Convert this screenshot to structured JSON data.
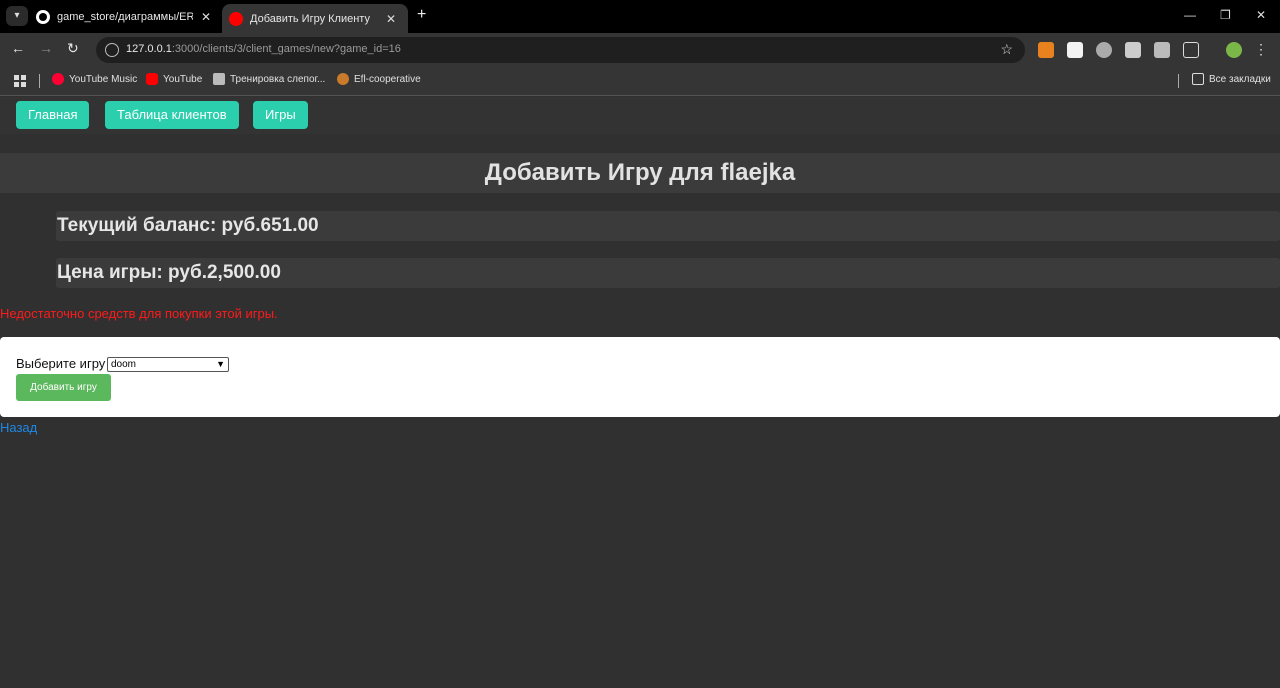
{
  "browser": {
    "tabs": [
      {
        "title": "game_store/диаграммы/ER_DI"
      },
      {
        "title": "Добавить Игру Клиенту"
      }
    ],
    "url_host": "127.0.0.1",
    "url_rest": ":3000/clients/3/client_games/new?game_id=16",
    "bookmarks": [
      {
        "label": "YouTube Music"
      },
      {
        "label": "YouTube"
      },
      {
        "label": "Тренировка слепог..."
      },
      {
        "label": "Efl-cooperative"
      }
    ],
    "all_bookmarks": "Все закладки"
  },
  "nav": {
    "home": "Главная",
    "clients": "Таблица клиентов",
    "games": "Игры"
  },
  "page": {
    "title": "Добавить Игру для flaejka",
    "balance": "Текущий баланс: руб.651.00",
    "price": "Цена игры: руб.2,500.00",
    "error": "Недостаточно средств для покупки этой игры.",
    "select_label": "Выберите игру",
    "selected_game": "doom",
    "submit": "Добавить игру",
    "back": "Назад"
  },
  "colors": {
    "nav_button": "#2bcfae",
    "submit_button": "#5cb85c",
    "error_text": "#ff1a1a",
    "link": "#1e88e5"
  }
}
